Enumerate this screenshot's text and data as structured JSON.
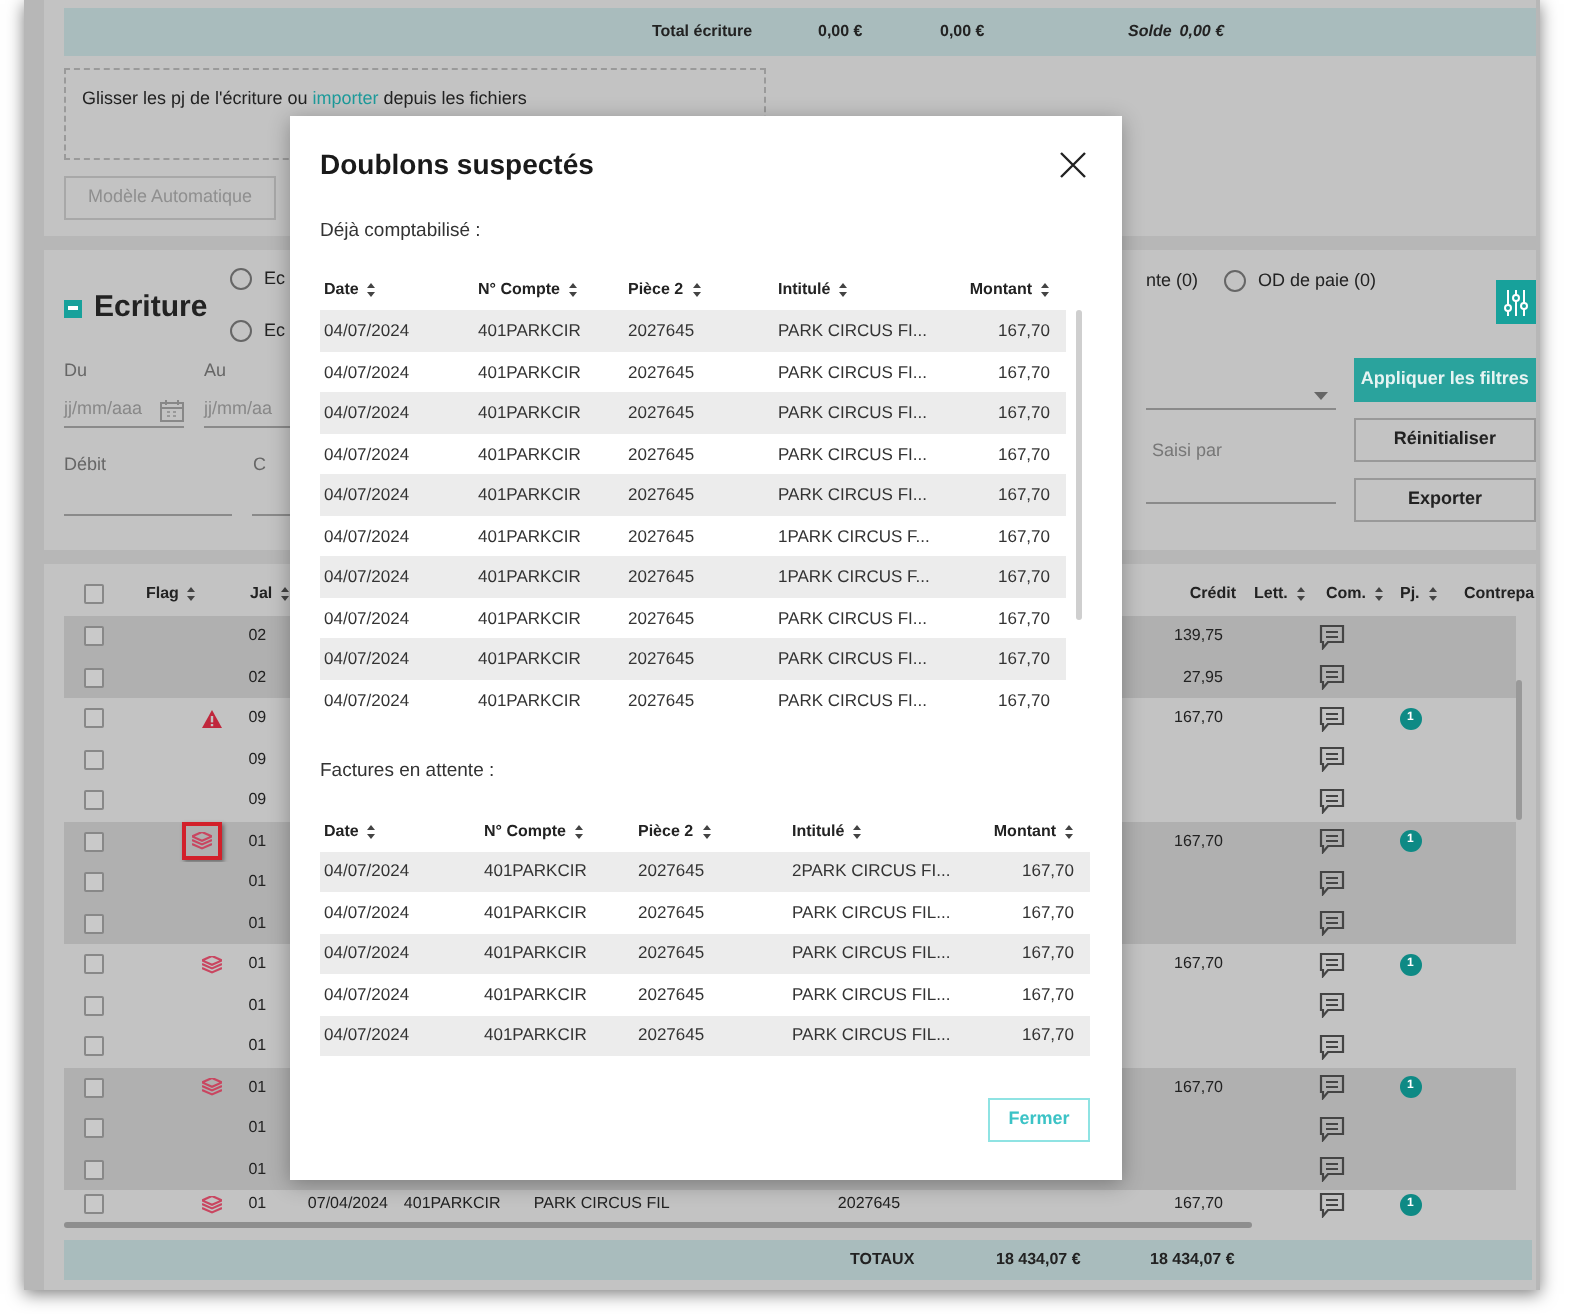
{
  "totals_bar": {
    "label": "Total écriture",
    "debit": "0,00 €",
    "credit": "0,00 €",
    "balance_label": "Solde",
    "balance": "0,00 €"
  },
  "dropzone": {
    "text": "Glisser les pj de l'écriture ou",
    "link": "importer",
    "text_after": "depuis les fichiers"
  },
  "template_button": {
    "label": "Modèle Automatique",
    "disabled": true
  },
  "filter_panel": {
    "title": "Ecriture",
    "expanded": true,
    "radios_left": [
      {
        "label": "Ec",
        "selected": false
      },
      {
        "label": "Ec",
        "selected": false
      }
    ],
    "radio_fragment": "nte (0)",
    "radios_right": [
      {
        "label": "OD de paie (0)",
        "selected": false
      }
    ],
    "date_fields": [
      {
        "label": "Du",
        "placeholder": "jj/mm/aaa",
        "calendar": true
      },
      {
        "label": "Au",
        "placeholder": "jj/mm/aa"
      }
    ],
    "amount_fields": [
      {
        "label": "Débit"
      },
      {
        "label": "C"
      }
    ],
    "saisi_field": {
      "label": "Saisi par"
    },
    "buttons": [
      {
        "label": "Appliquer les filtres",
        "kind": "primary"
      },
      {
        "label": "Réinitialiser",
        "kind": "secondary"
      },
      {
        "label": "Exporter",
        "kind": "secondary"
      }
    ]
  },
  "entries_table": {
    "all_checked": false,
    "columns_left": [
      {
        "label": "Flag",
        "sortable": true
      },
      {
        "label": "Jal",
        "sortable": true
      }
    ],
    "columns_right": [
      {
        "label": "Crédit",
        "sortable": false
      },
      {
        "label": "Lett.",
        "sortable": true
      },
      {
        "label": "Com.",
        "sortable": true
      },
      {
        "label": "Pj.",
        "sortable": true
      },
      {
        "label": "Contrepa",
        "sortable": false
      }
    ],
    "groups": [
      {
        "rows": [
          {
            "jal": "02",
            "kind": "plain",
            "checked": false,
            "credit": "139,75"
          },
          {
            "jal": "02",
            "kind": "plain",
            "checked": false,
            "credit": "27,95"
          }
        ]
      },
      {
        "rows": [
          {
            "jal": "09",
            "kind": "warning",
            "checked": false,
            "credit": "167,70",
            "attachments": "1"
          },
          {
            "jal": "09",
            "kind": "plain",
            "checked": false
          },
          {
            "jal": "09",
            "kind": "plain",
            "checked": false
          }
        ]
      },
      {
        "rows": [
          {
            "jal": "01",
            "kind": "duplicate",
            "checked": false,
            "highlighted": true,
            "credit": "167,70",
            "attachments": "1"
          },
          {
            "jal": "01",
            "kind": "plain",
            "checked": false
          },
          {
            "jal": "01",
            "kind": "plain",
            "checked": false
          }
        ]
      },
      {
        "rows": [
          {
            "jal": "01",
            "kind": "duplicate",
            "checked": false,
            "credit": "167,70",
            "attachments": "1"
          },
          {
            "jal": "01",
            "kind": "plain",
            "checked": false
          },
          {
            "jal": "01",
            "kind": "plain",
            "checked": false
          }
        ]
      },
      {
        "rows": [
          {
            "jal": "01",
            "kind": "duplicate",
            "checked": false,
            "credit": "167,70",
            "attachments": "1"
          },
          {
            "jal": "01",
            "kind": "plain",
            "checked": false
          },
          {
            "jal": "01",
            "kind": "plain",
            "checked": false
          }
        ]
      }
    ],
    "cut_row": {
      "jal": "01",
      "kind": "duplicate",
      "checked": false,
      "date": "07/04/2024",
      "account": "401PARKCIR",
      "label": "PARK CIRCUS FIL",
      "piece": "2027645",
      "credit": "167,70",
      "attachments": "1"
    }
  },
  "totals_footer": {
    "label": "TOTAUX",
    "debit": "18 434,07 €",
    "credit": "18 434,07 €"
  },
  "modal": {
    "title": "Doublons suspectés",
    "close_button": "Fermer",
    "sections": [
      {
        "heading": "Déjà comptabilisé :",
        "scrollable": true,
        "columns": [
          {
            "label": "Date",
            "sortable": true
          },
          {
            "label": "N° Compte",
            "sortable": true
          },
          {
            "label": "Pièce 2",
            "sortable": true
          },
          {
            "label": "Intitulé",
            "sortable": true
          },
          {
            "label": "Montant",
            "sortable": true
          }
        ],
        "rows": [
          [
            "04/07/2024",
            "401PARKCIR",
            "2027645",
            "PARK CIRCUS FI...",
            "167,70"
          ],
          [
            "04/07/2024",
            "401PARKCIR",
            "2027645",
            "PARK CIRCUS FI...",
            "167,70"
          ],
          [
            "04/07/2024",
            "401PARKCIR",
            "2027645",
            "PARK CIRCUS FI...",
            "167,70"
          ],
          [
            "04/07/2024",
            "401PARKCIR",
            "2027645",
            "PARK CIRCUS FI...",
            "167,70"
          ],
          [
            "04/07/2024",
            "401PARKCIR",
            "2027645",
            "PARK CIRCUS FI...",
            "167,70"
          ],
          [
            "04/07/2024",
            "401PARKCIR",
            "2027645",
            "1PARK CIRCUS F...",
            "167,70"
          ],
          [
            "04/07/2024",
            "401PARKCIR",
            "2027645",
            "1PARK CIRCUS F...",
            "167,70"
          ],
          [
            "04/07/2024",
            "401PARKCIR",
            "2027645",
            "PARK CIRCUS FI...",
            "167,70"
          ],
          [
            "04/07/2024",
            "401PARKCIR",
            "2027645",
            "PARK CIRCUS FI...",
            "167,70"
          ],
          [
            "04/07/2024",
            "401PARKCIR",
            "2027645",
            "PARK CIRCUS FI...",
            "167,70"
          ]
        ]
      },
      {
        "heading": "Factures en attente :",
        "scrollable": false,
        "columns": [
          {
            "label": "Date",
            "sortable": true
          },
          {
            "label": "N° Compte",
            "sortable": true
          },
          {
            "label": "Pièce 2",
            "sortable": true
          },
          {
            "label": "Intitulé",
            "sortable": true
          },
          {
            "label": "Montant",
            "sortable": true
          }
        ],
        "rows": [
          [
            "04/07/2024",
            "401PARKCIR",
            "2027645",
            "2PARK CIRCUS FI...",
            "167,70"
          ],
          [
            "04/07/2024",
            "401PARKCIR",
            "2027645",
            "PARK CIRCUS FIL...",
            "167,70"
          ],
          [
            "04/07/2024",
            "401PARKCIR",
            "2027645",
            "PARK CIRCUS FIL...",
            "167,70"
          ],
          [
            "04/07/2024",
            "401PARKCIR",
            "2027645",
            "PARK CIRCUS FIL...",
            "167,70"
          ],
          [
            "04/07/2024",
            "401PARKCIR",
            "2027645",
            "PARK CIRCUS FIL...",
            "167,70"
          ]
        ]
      }
    ]
  }
}
